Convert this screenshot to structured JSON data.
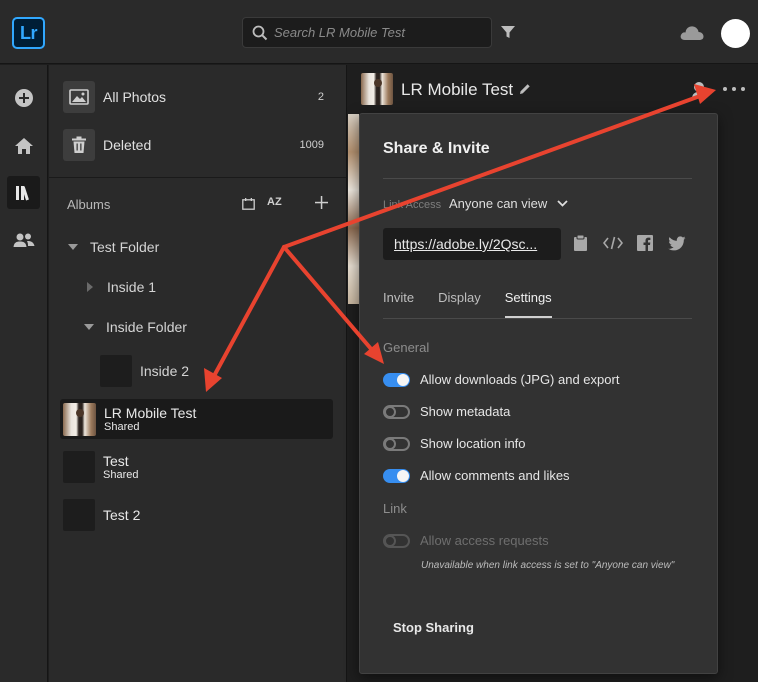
{
  "app": {
    "logo_text": "Lr",
    "brand_color": "#31a8ff"
  },
  "search": {
    "placeholder": "Search LR Mobile Test"
  },
  "topbar": {
    "icons": [
      "search-icon",
      "filter-icon",
      "cloud-icon",
      "user-avatar"
    ]
  },
  "rail": {
    "items": [
      "add-icon",
      "home-icon",
      "library-icon",
      "people-icon"
    ],
    "active": "library-icon"
  },
  "sidebar": {
    "all_photos": {
      "label": "All Photos",
      "count": "2"
    },
    "deleted": {
      "label": "Deleted",
      "count": "1009"
    },
    "albums_label": "Albums",
    "sort_label": "AZ",
    "tree": {
      "test_folder": "Test Folder",
      "inside_1": "Inside 1",
      "inside_folder": "Inside Folder",
      "inside_2": "Inside 2"
    },
    "albums": [
      {
        "name": "LR Mobile Test",
        "sub": "Shared"
      },
      {
        "name": "Test",
        "sub": "Shared"
      },
      {
        "name": "Test 2",
        "sub": ""
      }
    ]
  },
  "main": {
    "title": "LR Mobile Test"
  },
  "share": {
    "title": "Share & Invite",
    "link_access_label": "Link Access",
    "link_access_value": "Anyone can view",
    "url": "https://adobe.ly/2Qsc...",
    "tabs": [
      "Invite",
      "Display",
      "Settings"
    ],
    "active_tab": "Settings",
    "general_label": "General",
    "toggles": [
      {
        "label": "Allow downloads (JPG) and export",
        "on": true
      },
      {
        "label": "Show metadata",
        "on": false
      },
      {
        "label": "Show location info",
        "on": false
      },
      {
        "label": "Allow comments and likes",
        "on": true
      }
    ],
    "link_label": "Link",
    "access_requests": {
      "label": "Allow access requests",
      "on": false,
      "disabled": true
    },
    "note": "Unavailable when link access is set to \"Anyone can view\"",
    "stop_label": "Stop Sharing"
  },
  "colors": {
    "toggle_on": "#378ef0",
    "annotation_arrow": "#e8432f"
  }
}
